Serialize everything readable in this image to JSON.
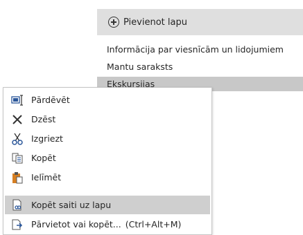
{
  "pages_panel": {
    "add_page_label": "Pievienot lapu",
    "pages": [
      {
        "title": "Informācija par viesnīcām un lidojumiem",
        "selected": false
      },
      {
        "title": "Mantu saraksts",
        "selected": false
      },
      {
        "title": "Ekskursijas",
        "selected": true
      }
    ]
  },
  "context_menu": {
    "items": [
      {
        "label": "Pārdēvēt",
        "icon": "rename-icon"
      },
      {
        "label": "Dzēst",
        "icon": "delete-icon"
      },
      {
        "label": "Izgriezt",
        "icon": "cut-icon"
      },
      {
        "label": "Kopēt",
        "icon": "copy-icon"
      },
      {
        "label": "Ielīmēt",
        "icon": "paste-icon"
      },
      {
        "label": "Kopēt saiti uz lapu",
        "icon": "copy-link-icon",
        "highlighted": true
      },
      {
        "label": "Pārvietot vai kopēt...",
        "icon": "move-copy-icon",
        "shortcut": "(Ctrl+Alt+M)"
      }
    ]
  },
  "colors": {
    "panel_header": "#dfdfdf",
    "selected_page": "#c8c8c8",
    "menu_highlight": "#cfcfcf",
    "icon_blue": "#2b579a",
    "icon_orange": "#d67f22"
  }
}
